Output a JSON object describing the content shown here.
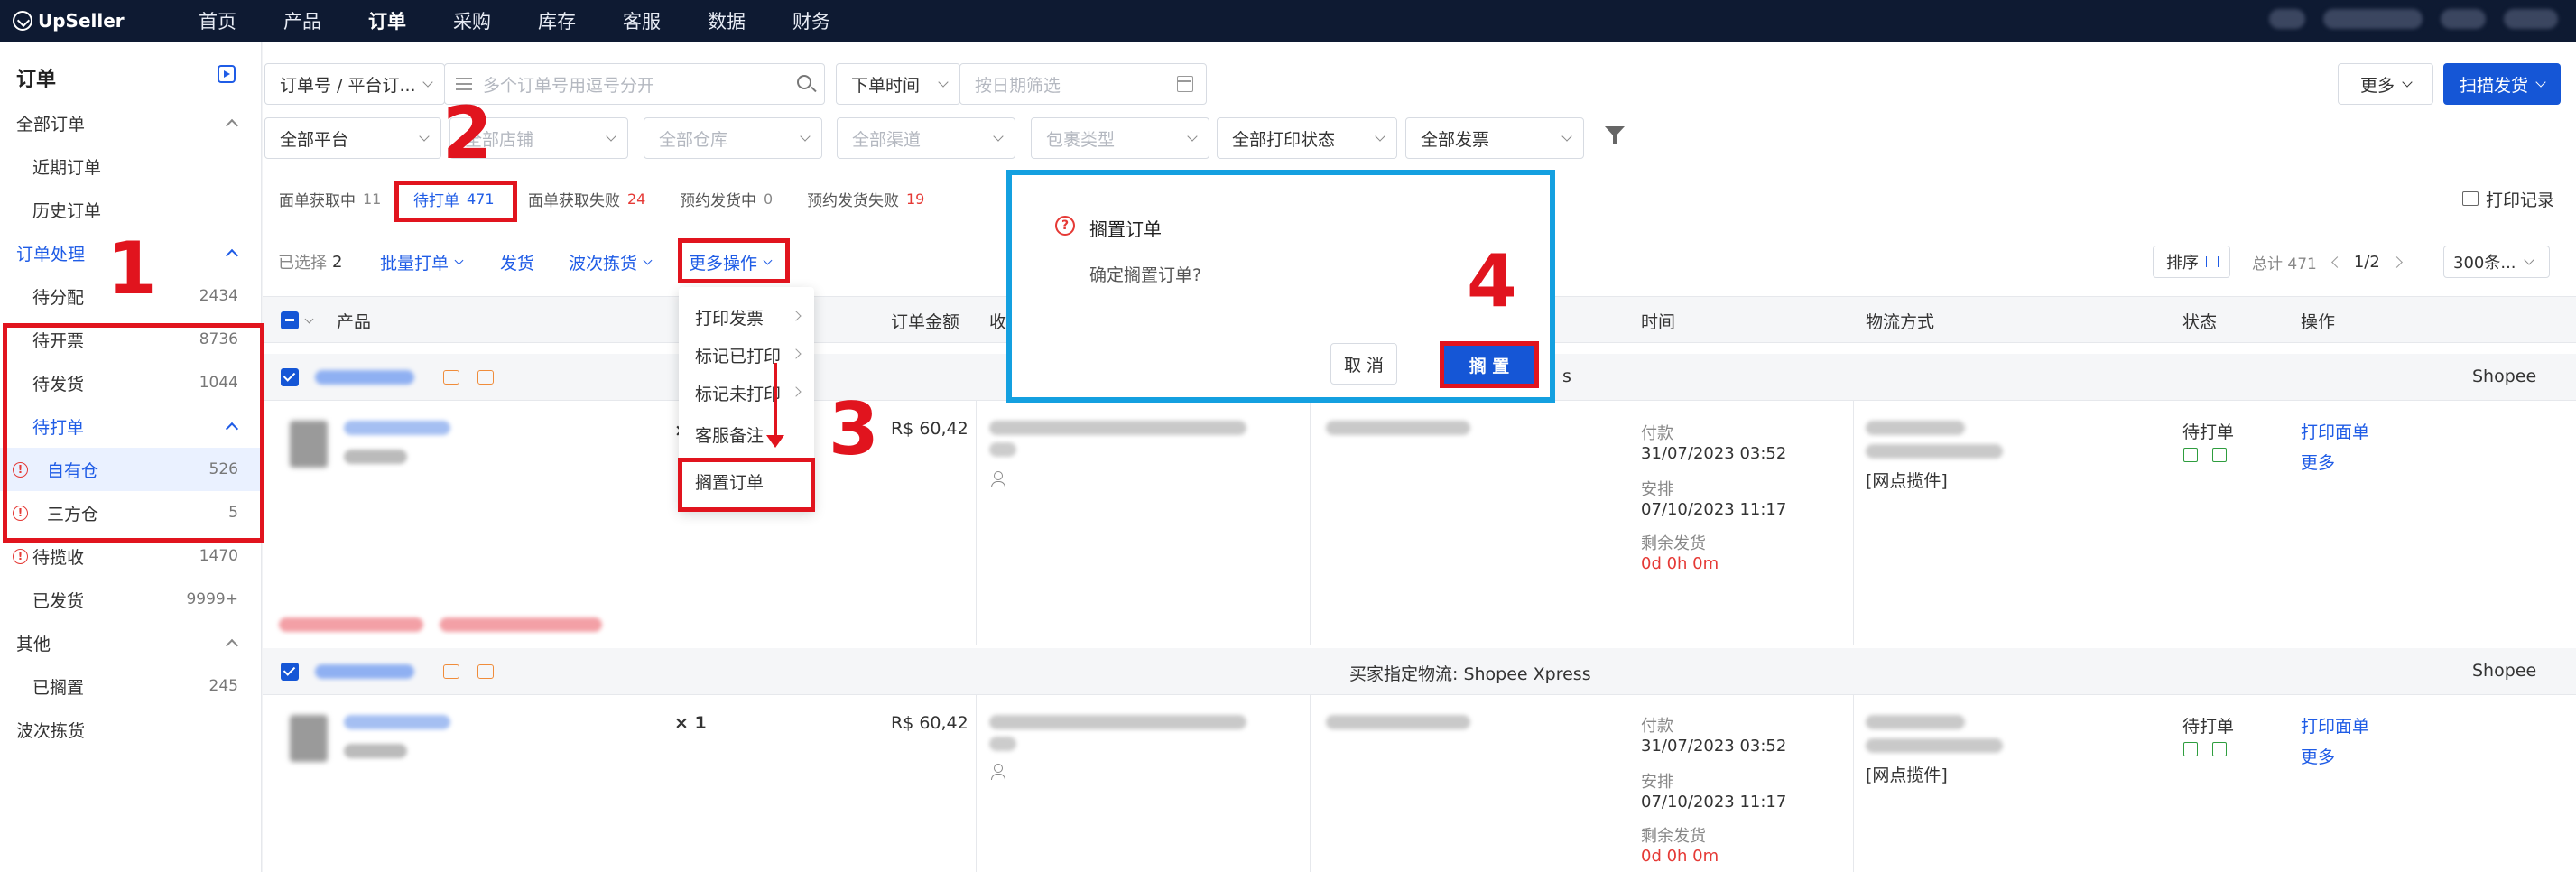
{
  "topnav": {
    "brand": "UpSeller",
    "items": [
      "首页",
      "产品",
      "订单",
      "采购",
      "库存",
      "客服",
      "数据",
      "财务"
    ],
    "active_index": 2
  },
  "sidebar": {
    "title": "订单",
    "all_orders": "全部订单",
    "recent_orders": "近期订单",
    "history_orders": "历史订单",
    "processing": "订单处理",
    "to_assign": {
      "label": "待分配",
      "count": "2434"
    },
    "to_invoice": {
      "label": "待开票",
      "count": "8736"
    },
    "to_ship": {
      "label": "待发货",
      "count": "1044"
    },
    "to_print": "待打单",
    "own_warehouse": {
      "label": "自有仓",
      "count": "526"
    },
    "third_party": {
      "label": "三方仓",
      "count": "5"
    },
    "to_collect": {
      "label": "待揽收",
      "count": "1470"
    },
    "shipped": {
      "label": "已发货",
      "count": "9999+"
    },
    "other": "其他",
    "shelved": {
      "label": "已搁置",
      "count": "245"
    },
    "wave_pick": "波次拣货"
  },
  "filters": {
    "search_type": "订单号 / 平台订...",
    "search_placeholder": "多个订单号用逗号分开",
    "time_type": "下单时间",
    "date_placeholder": "按日期筛选",
    "platform": "全部平台",
    "store": "全部店铺",
    "warehouse": "全部仓库",
    "channel": "全部渠道",
    "package_type": "包裹类型",
    "print_status": "全部打印状态",
    "invoice": "全部发票"
  },
  "header_buttons": {
    "more": "更多",
    "scan_ship": "扫描发货"
  },
  "status_tabs": [
    {
      "label": "面单获取中",
      "count": "11",
      "red": false
    },
    {
      "label": "待打单",
      "count": "471",
      "red": false
    },
    {
      "label": "面单获取失败",
      "count": "24",
      "red": true
    },
    {
      "label": "预约发货中",
      "count": "0",
      "red": false
    },
    {
      "label": "预约发货失败",
      "count": "19",
      "red": true
    }
  ],
  "print_log": "打印记录",
  "toolbar": {
    "selected_label": "已选择",
    "selected_count": "2",
    "batch_print": "批量打单",
    "ship": "发货",
    "wave_pick": "波次拣货",
    "more_actions": "更多操作",
    "sort": "排序",
    "total": "总计 471",
    "page": "1/2",
    "per_page": "300条..."
  },
  "table": {
    "headers": {
      "product": "产品",
      "amount": "订单金额",
      "recipient": "收",
      "time": "时间",
      "logistics": "物流方式",
      "status": "状态",
      "action": "操作"
    },
    "group2_logistics": "买家指定物流: Shopee Xpress",
    "group1_logistics_tail": "s",
    "platform": "Shopee",
    "orders": [
      {
        "qty": "× 1",
        "amount": "R$ 60,42",
        "pay_label": "付款",
        "pay_time": "31/07/2023 03:52",
        "arrange_label": "安排",
        "arrange_time": "07/10/2023 11:17",
        "remain_label": "剩余发货",
        "remain": "0d 0h 0m",
        "pickup": "[网点揽件]",
        "status": "待打单",
        "print": "打印面单",
        "more": "更多"
      },
      {
        "qty": "× 1",
        "amount": "R$ 60,42",
        "pay_label": "付款",
        "pay_time": "31/07/2023 03:52",
        "arrange_label": "安排",
        "arrange_time": "07/10/2023 11:17",
        "remain_label": "剩余发货",
        "remain": "0d 0h 0m",
        "pickup": "[网点揽件]",
        "status": "待打单",
        "print": "打印面单",
        "more": "更多"
      }
    ]
  },
  "menu": {
    "items": [
      "打印发票",
      "标记已打印",
      "标记未打印",
      "客服备注",
      "搁置订单"
    ]
  },
  "dialog": {
    "title": "搁置订单",
    "message": "确定搁置订单?",
    "cancel": "取 消",
    "ok": "搁 置"
  },
  "annotations": [
    "1",
    "2",
    "3",
    "4"
  ],
  "colors": {
    "accent": "#1556d6",
    "annotation": "#e1141e",
    "dialog_border": "#14a0e0",
    "nav_bg": "#0e1a32"
  }
}
